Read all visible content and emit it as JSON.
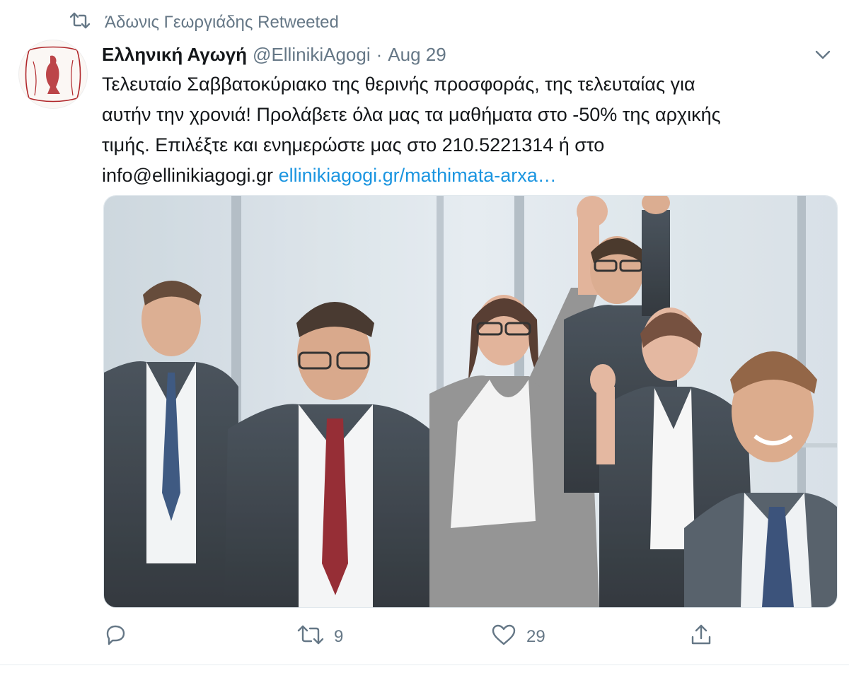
{
  "retweet": {
    "label": "Άδωνις Γεωργιάδης Retweeted"
  },
  "tweet": {
    "display_name": "Ελληνική Αγωγή",
    "handle": "@EllinikiAgogi",
    "separator": "·",
    "date": "Aug 29",
    "text_lines": [
      "Τελευταίο Σαββατοκύριακο της θερινής προσφοράς, της τελευταίας για",
      "αυτήν την χρονιά! Προλάβετε όλα μας τα μαθήματα στο -50% της αρχικής",
      "τιμής. Επιλέξτε και ενημερώστε μας στο 210.5221314 ή στο",
      "info@ellinikiagogi.gr"
    ],
    "link_text": "ellinikiagogi.gr/mathimata-arxa…"
  },
  "actions": {
    "reply_count": "",
    "retweet_count": "9",
    "like_count": "29"
  },
  "icons": [
    "retweet-icon",
    "chevron-down-icon",
    "reply-icon",
    "like-icon",
    "share-icon"
  ],
  "colors": {
    "accent": "#1b95e0",
    "muted": "#657786",
    "text": "#14171a"
  }
}
